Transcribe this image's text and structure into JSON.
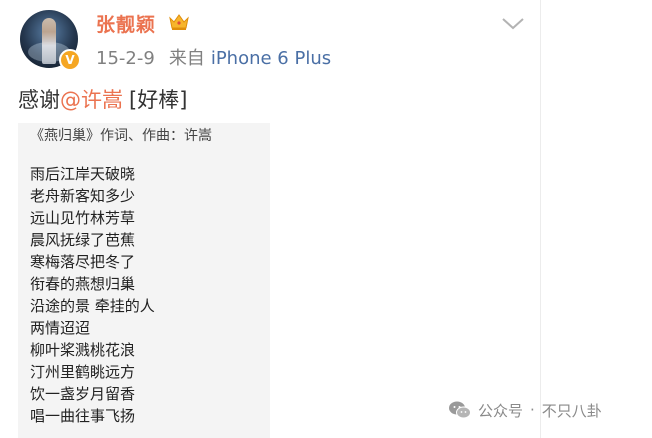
{
  "post": {
    "author": {
      "name": "张靓颖",
      "verified_badge": "V",
      "vip_icon": "crown-icon"
    },
    "meta": {
      "date": "15-2-9",
      "via_label": "来自",
      "device": "iPhone 6 Plus"
    },
    "text": {
      "prefix": "感谢",
      "mention": "@许嵩",
      "emoji": "[好棒]"
    },
    "more_icon": "chevron-down-icon"
  },
  "lyrics_image": {
    "title": "《燕归巢》作词、作曲：许嵩",
    "lines": [
      "雨后江岸天破晓",
      "老舟新客知多少",
      "远山见竹林芳草",
      "晨风抚绿了芭蕉",
      "寒梅落尽把冬了",
      "衔春的燕想归巢",
      "沿途的景 牵挂的人",
      "两情迢迢",
      "柳叶桨溅桃花浪",
      "汀州里鹤眺远方",
      "饮一盏岁月留香",
      "唱一曲往事飞扬"
    ]
  },
  "watermark": {
    "icon": "wechat-icon",
    "label": "公众号",
    "separator": "·",
    "account": "不只八卦"
  },
  "colors": {
    "accent": "#eb7350",
    "device_link": "#4a6fa5",
    "meta": "#808080",
    "badge": "#f5a623"
  }
}
